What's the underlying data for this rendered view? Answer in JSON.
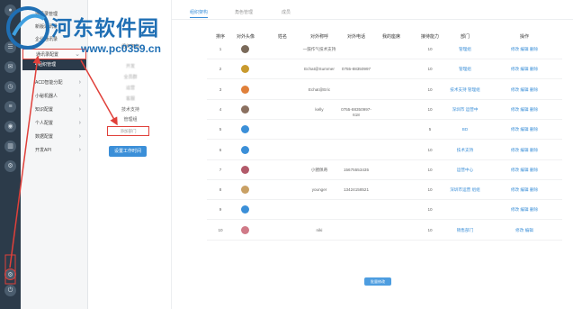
{
  "watermark": {
    "title": "河东软件园",
    "url": "www.pc0359.cn"
  },
  "menu": {
    "items": [
      {
        "label": "通讯录管理",
        "chevron": ""
      },
      {
        "label": "新版通讯录",
        "chevron": ""
      },
      {
        "label": "企业通讯录",
        "chevron": ""
      },
      {
        "label": "组织架构",
        "chevron": ""
      },
      {
        "label": "通讯录配置",
        "chevron": "⌄"
      },
      {
        "label": "• 组织管理",
        "chevron": ""
      },
      {
        "label": "ACD智能分配",
        "chevron": "›"
      },
      {
        "label": "小秘机器人",
        "chevron": "›"
      },
      {
        "label": "知识配置",
        "chevron": "›"
      },
      {
        "label": "个人配置",
        "chevron": "›"
      },
      {
        "label": "数据配置",
        "chevron": "›"
      },
      {
        "label": "开发API",
        "chevron": "›"
      }
    ]
  },
  "tree": {
    "root": "组织架构",
    "nodes": [
      "开发",
      "全员群",
      "运营",
      "客服",
      "技术支持",
      "管理组"
    ],
    "add_dept": "添加部门",
    "set_hours": "设置工作时间"
  },
  "tabs": [
    "组织架构",
    "角色管理",
    "成员"
  ],
  "table": {
    "headers": [
      "排序",
      "对外头像",
      "姓名",
      "对外称呼",
      "对外电话",
      "我的座席",
      "接待能力",
      "部门",
      "操作"
    ],
    "rows": [
      {
        "no": "1",
        "name": "",
        "alias": "一鼓作气技术支持",
        "phone": "",
        "seat": "",
        "cap": "10",
        "dept": "管理组",
        "ops": "修改 编辑 删除"
      },
      {
        "no": "2",
        "name": "",
        "alias": "Echat@Summer",
        "phone": "0755-88350997",
        "seat": "",
        "cap": "10",
        "dept": "管理组",
        "ops": "修改 编辑 删除"
      },
      {
        "no": "3",
        "name": "",
        "alias": "Echat@Eric",
        "phone": "",
        "seat": "",
        "cap": "10",
        "dept": "技术支持\n管理组",
        "ops": "修改 编辑 删除"
      },
      {
        "no": "4",
        "name": "",
        "alias": "kelly",
        "phone": "0755-88350997-\n618",
        "seat": "",
        "cap": "10",
        "dept": "深圳市\n运营中",
        "ops": "修改 编辑 删除"
      },
      {
        "no": "5",
        "name": "",
        "alias": "",
        "phone": "",
        "seat": "",
        "cap": "5",
        "dept": "BD",
        "ops": "修改 编辑 删除"
      },
      {
        "no": "6",
        "name": "",
        "alias": "",
        "phone": "",
        "seat": "",
        "cap": "10",
        "dept": "技术支持",
        "ops": "修改 编辑 删除"
      },
      {
        "no": "7",
        "name": "",
        "alias": "小猪佩奇",
        "phone": "15675553435",
        "seat": "",
        "cap": "10",
        "dept": "运营中心",
        "ops": "修改 编辑 删除"
      },
      {
        "no": "8",
        "name": "",
        "alias": "younger",
        "phone": "13424158521",
        "seat": "",
        "cap": "10",
        "dept": "深圳市运营\n组组",
        "ops": "修改 编辑 删除"
      },
      {
        "no": "9",
        "name": "",
        "alias": "",
        "phone": "",
        "seat": "",
        "cap": "10",
        "dept": "",
        "ops": "修改 编辑 删除"
      },
      {
        "no": "10",
        "name": "",
        "alias": "niki",
        "phone": "",
        "seat": "",
        "cap": "10",
        "dept": "销售部门",
        "ops": "修改 编辑"
      }
    ]
  },
  "footer": {
    "save": "批量修改"
  },
  "colors": {
    "rail": "#2c3b4a",
    "accent": "#3b8fd8",
    "highlight": "#e0403a"
  }
}
